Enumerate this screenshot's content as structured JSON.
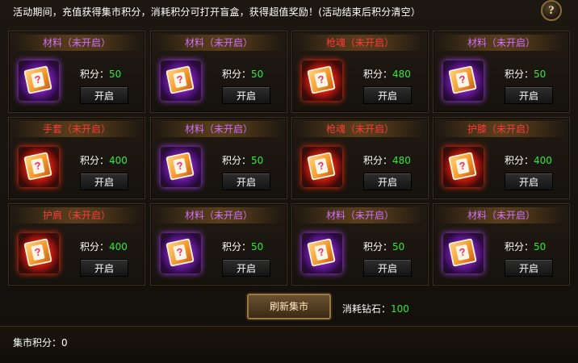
{
  "notice": "活动期间，充值获得集市积分，消耗积分可打开盲盒，获得超值奖励！(活动结束后积分清空）",
  "help_label": "?",
  "score_label": "积分：",
  "open_label": "开启",
  "cards": [
    {
      "title": "材料（未开启）",
      "rarity": "purple",
      "score": "50"
    },
    {
      "title": "材料（未开启）",
      "rarity": "purple",
      "score": "50"
    },
    {
      "title": "枪魂（未开启）",
      "rarity": "red",
      "score": "480"
    },
    {
      "title": "材料（未开启）",
      "rarity": "purple",
      "score": "50"
    },
    {
      "title": "手套（未开启）",
      "rarity": "red",
      "score": "400"
    },
    {
      "title": "材料（未开启）",
      "rarity": "purple",
      "score": "50"
    },
    {
      "title": "枪魂（未开启）",
      "rarity": "red",
      "score": "480"
    },
    {
      "title": "护膝（未开启）",
      "rarity": "red",
      "score": "400"
    },
    {
      "title": "护肩（未开启）",
      "rarity": "red",
      "score": "400"
    },
    {
      "title": "材料（未开启）",
      "rarity": "purple",
      "score": "50"
    },
    {
      "title": "材料（未开启）",
      "rarity": "purple",
      "score": "50"
    },
    {
      "title": "材料（未开启）",
      "rarity": "purple",
      "score": "50"
    }
  ],
  "refresh_label": "刷新集市",
  "cost_label": "消耗钻石：",
  "cost_value": "100",
  "market_points_label": "集市积分：",
  "market_points_value": "0",
  "colors": {
    "purple": "#d070ff",
    "red": "#ff3a3a",
    "green": "#36e836"
  }
}
